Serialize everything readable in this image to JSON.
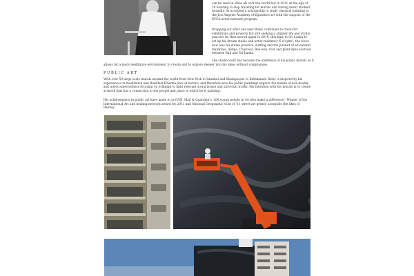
{
  "about": {
    "paragraph_1": "can be seen in cities all over the world but in 2011 at the age of 20 wanting to stop traveling for murals and having never studied formally, he accepted a scholarship to study classical painting at the Los Angeles Academy of figurative art with the support of the KVCA artist network program.",
    "paragraph_2": "Dropping out after one year Ricky continued to travel for exhibitions and projects but still seeking a simpler life and studio practice he then moved again in 2019, this time to Sri Lanka to set up his dream studio and artist residency X a\"synn\", the focus now was his studio practice, surfing and the pursuit of all natural materials, Indigo, Charcoal, Bee wax, rust and plant dyes sourced between Bali and Sri Lanka.",
    "paragraph_3_line_1": "His studio work has become the antithesis of his public murals as it",
    "paragraph_3_line_2": "allows for a more meditative environment to create and  to explore deeper into his ideas without compromise."
  },
  "public_art": {
    "heading": "PUBLIC ART",
    "paragraph_1": "With over 50 large scale murals around the world from New York to Istanbul and Madagascar to Kathmandu Ricky is inspired by his experiences in meditation and Buddhist Dharma (law of nature) and therefore now his public paintings explore the nature of non-duality and interconnectedness focusing on bringing to light relevant social issues and universal truths. His intention with his murals is to create artwork that has a connection to the people and place in which he is painting.",
    "paragraph_2": "His achievements in public art have made it on CNN, Mail & Guardian's '200 young people in SA who make a difference', Winner of the International Art and healing network award for 2011 and National Geographic's list of '11 street art greats' alongside the likes of Banksy.."
  },
  "colors": {
    "background": "#ffffff",
    "text": "#2a2a2a",
    "lift_orange": "#e0521c",
    "sky_blue": "#5a86b8"
  }
}
